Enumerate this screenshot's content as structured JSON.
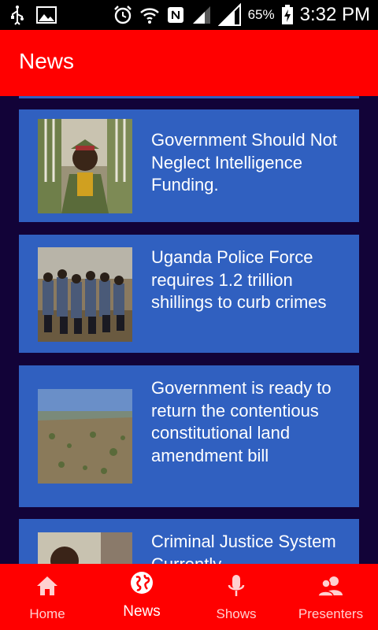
{
  "status_bar": {
    "battery_percent": "65%",
    "time": "3:32 PM",
    "icons": [
      "usb-icon",
      "image-icon",
      "alarm-icon",
      "wifi-icon",
      "nfc-icon",
      "signal-icon",
      "signal-icon",
      "battery-charging-icon"
    ]
  },
  "app_bar": {
    "title": "News"
  },
  "news": {
    "items": [
      {
        "title": "Government Should Not Neglect Intelligence Funding.",
        "thumbnail": "military-officer-photo"
      },
      {
        "title": "Uganda Police Force requires 1.2 trillion shillings to curb crimes",
        "thumbnail": "police-officers-photo"
      },
      {
        "title": "Government is ready to return the contentious constitutional land amendment bill",
        "thumbnail": "land-landscape-photo"
      },
      {
        "title": "Criminal Justice System Currently",
        "thumbnail": "person-photo"
      }
    ]
  },
  "bottom_nav": {
    "items": [
      {
        "label": "Home",
        "icon": "home-icon",
        "active": false
      },
      {
        "label": "News",
        "icon": "globe-icon",
        "active": true
      },
      {
        "label": "Shows",
        "icon": "microphone-icon",
        "active": false
      },
      {
        "label": "Presenters",
        "icon": "people-icon",
        "active": false
      }
    ]
  },
  "colors": {
    "primary": "#ff0000",
    "card": "#3060c0",
    "background": "#120338",
    "status_bar": "#000000"
  }
}
